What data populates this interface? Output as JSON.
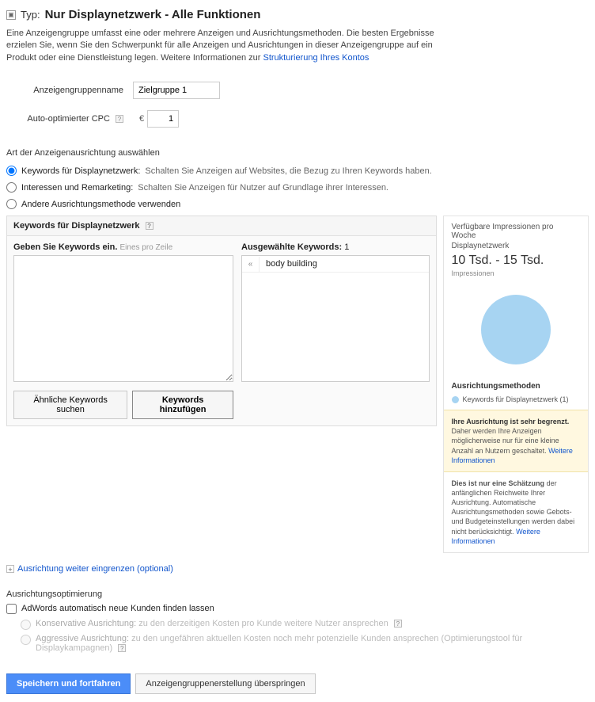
{
  "header": {
    "typ_label": "Typ:",
    "typ_value": "Nur Displaynetzwerk - Alle Funktionen"
  },
  "desc": {
    "text1": "Eine Anzeigengruppe umfasst eine oder mehrere Anzeigen und Ausrichtungsmethoden. Die besten Ergebnisse erzielen Sie, wenn Sie den Schwerpunkt für alle Anzeigen und Ausrichtungen in dieser Anzeigengruppe auf ein Produkt oder eine Dienstleistung legen. Weitere Informationen zur ",
    "link": "Strukturierung Ihres Kontos"
  },
  "form": {
    "group_label": "Anzeigengruppenname",
    "group_value": "Zielgruppe 1",
    "cpc_label": "Auto-optimierter CPC",
    "currency": "€",
    "cpc_value": "1"
  },
  "targeting": {
    "heading": "Art der Anzeigenausrichtung auswählen",
    "options": [
      {
        "label": "Keywords für Displaynetzwerk:",
        "desc": " Schalten Sie Anzeigen auf Websites, die Bezug zu Ihren Keywords haben."
      },
      {
        "label": "Interessen und Remarketing:",
        "desc": " Schalten Sie Anzeigen für Nutzer auf Grundlage ihrer Interessen."
      },
      {
        "label": "Andere Ausrichtungsmethode verwenden",
        "desc": ""
      }
    ]
  },
  "kw": {
    "panel_title": "Keywords für Displaynetzwerk",
    "enter_label": "Geben Sie Keywords ein.",
    "enter_hint": "Eines pro Zeile",
    "selected_label": "Ausgewählte Keywords:",
    "selected_count": "1",
    "selected_items": [
      "body building"
    ],
    "btn_similar": "Ähnliche Keywords suchen",
    "btn_add": "Keywords hinzufügen"
  },
  "side": {
    "title": "Verfügbare Impressionen pro Woche",
    "network": "Displaynetzwerk",
    "range": "10 Tsd. - 15 Tsd.",
    "sub": "Impressionen",
    "methods_label": "Ausrichtungsmethoden",
    "legend": "Keywords für Displaynetzwerk (1)",
    "warn_bold": "Ihre Ausrichtung ist sehr begrenzt.",
    "warn_text": " Daher werden Ihre Anzeigen möglicherweise nur für eine kleine Anzahl an Nutzern geschaltet. ",
    "warn_link": "Weitere Informationen",
    "est_bold": "Dies ist nur eine Schätzung",
    "est_text": " der anfänglichen Reichweite Ihrer Ausrichtung. Automatische Ausrichtungsmethoden sowie Gebots- und Budgeteinstellungen werden dabei nicht berücksichtigt. ",
    "est_link": "Weitere Informationen"
  },
  "expand": {
    "text": "Ausrichtung weiter eingrenzen (optional)"
  },
  "opt": {
    "heading": "Ausrichtungsoptimierung",
    "chk_label": "AdWords automatisch neue Kunden finden lassen",
    "cons_label": "Konservative Ausrichtung:",
    "cons_desc": " zu den derzeitigen Kosten pro Kunde weitere Nutzer ansprechen",
    "agg_label": "Aggressive Ausrichtung:",
    "agg_desc": " zu den ungefähren aktuellen Kosten noch mehr potenzielle Kunden ansprechen (Optimierungstool für Displaykampagnen)"
  },
  "footer": {
    "save": "Speichern und fortfahren",
    "skip": "Anzeigengruppenerstellung überspringen"
  }
}
